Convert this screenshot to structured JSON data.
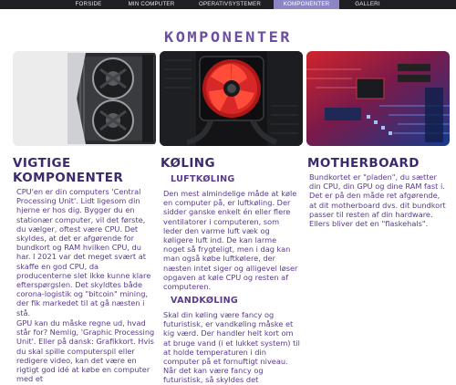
{
  "nav": {
    "items": [
      {
        "label": "FORSIDE"
      },
      {
        "label": "MIN COMPUTER"
      },
      {
        "label": "OPERATIVSYSTEMER"
      },
      {
        "label": "KOMPONENTER"
      },
      {
        "label": "GALLERI"
      }
    ],
    "active_index": 3,
    "active_color": "#8d86c4"
  },
  "page": {
    "title": "KOMPONENTER"
  },
  "columns": {
    "left": {
      "heading": "VIGTIGE KOMPONENTER",
      "paragraphs": [
        "CPU'en er din computers 'Central Processing Unit'. Lidt ligesom din hjerne er hos dig. Bygger du en stationær computer, vil det første, du vælger, oftest være CPU. Det skyldes, at det er afgørende for bundkort og RAM hvilken CPU, du har. I 2021 var det meget svært at skaffe en god CPU, da producenterne slet ikke kunne klare efterspørgslen. Det skyldtes både corona-logistik og \"bitcoin\" mining, der fik markedet til at gå næsten i stå.",
        "GPU kan du måske regne ud, hvad står for? Nemlig, 'Graphic Processing Unit'. Eller på dansk: Grafikkort. Hvis du skal spille computerspil eller redigere video, kan det være en rigtigt god idé at købe en computer med et"
      ]
    },
    "middle": {
      "heading": "KØLING",
      "subsections": [
        {
          "heading": "LUFTKØLING",
          "text": "Den mest almindelige måde at køle en computer på, er luftkøling. Der sidder ganske enkelt én eller flere ventilatorer i computeren, som leder den varme luft væk og køligere luft ind. De kan larme noget så frygteligt, men i dag kan man også købe luftkølere, der næsten intet siger og alligevel løser opgaven at køle CPU og resten af computeren."
        },
        {
          "heading": "VANDKØLING",
          "text": "Skal din køling være fancy og futuristisk, er vandkøling måske et kig værd. Der handler helt kort om at bruge vand (i et lukket system) til at holde temperaturen i din computer på et fornuftigt niveau. Når det kan være fancy og futuristisk, så skyldes det"
        }
      ]
    },
    "right": {
      "heading": "MOTHERBOARD",
      "paragraphs": [
        "Bundkortet er \"pladen\", du sætter din CPU, din GPU og dine RAM fast i. Det er på den måde ret afgørende, at dit motherboard dvs. dit bundkort passer til resten af din hardware. Ellers bliver det en \"flaskehals\"."
      ]
    }
  },
  "images": [
    {
      "icon": "graphics-card-image"
    },
    {
      "icon": "cpu-cooler-fan-image"
    },
    {
      "icon": "motherboard-image"
    }
  ]
}
